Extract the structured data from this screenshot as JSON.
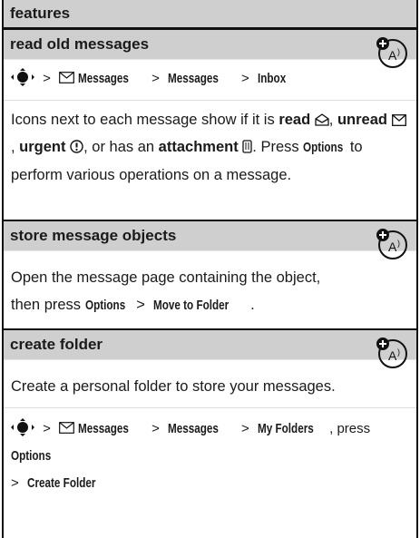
{
  "header": {
    "title": "features"
  },
  "sections": [
    {
      "title": "read old messages",
      "path": [
        "Messages",
        "Messages",
        "Inbox"
      ],
      "desc": {
        "icons_next": "Icons next to each message show if it is",
        "read": "read",
        "unread": "unread",
        "urgent": "urgent",
        "or_has": ", or has an",
        "attachment": "attachment",
        "press": "Press",
        "options": "Options",
        "rest": "to perform various operations on a message."
      }
    },
    {
      "title": "store message objects",
      "text_a": "Open the message page containing the object, then press",
      "options": "Options",
      "move": "Move to Folder"
    },
    {
      "title": "create folder",
      "text": "Create a personal folder to store your messages.",
      "path": [
        "Messages",
        "Messages",
        "My Folders"
      ],
      "press": ", press",
      "options": "Options",
      "create": "Create Folder"
    }
  ],
  "icons": [
    "network-service-icon",
    "nav-key-icon",
    "envelope-icon",
    "read-icon",
    "unread-icon",
    "urgent-icon",
    "attachment-icon"
  ]
}
